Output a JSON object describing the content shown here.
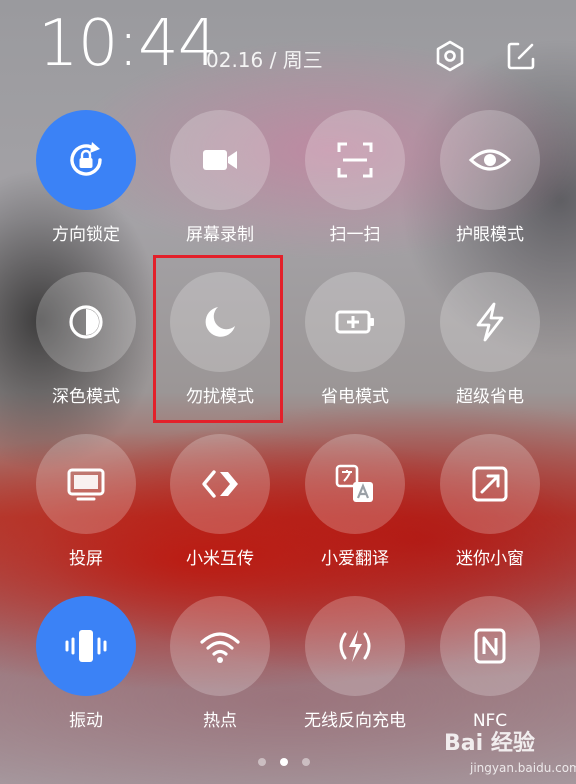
{
  "header": {
    "time": "10:44",
    "date": "02.16 / 周三",
    "settings_icon": "settings-hexagon-icon",
    "edit_icon": "edit-pencil-icon"
  },
  "accent_color": "#3b82f6",
  "highlight_color": "#e3202a",
  "tiles": [
    {
      "label": "方向锁定",
      "icon": "rotation-lock-icon",
      "active": true
    },
    {
      "label": "屏幕录制",
      "icon": "video-camera-icon",
      "active": false
    },
    {
      "label": "扫一扫",
      "icon": "scan-icon",
      "active": false
    },
    {
      "label": "护眼模式",
      "icon": "eye-icon",
      "active": false
    },
    {
      "label": "深色模式",
      "icon": "dark-mode-icon",
      "active": false
    },
    {
      "label": "勿扰模式",
      "icon": "moon-icon",
      "active": false,
      "highlighted": true
    },
    {
      "label": "省电模式",
      "icon": "battery-saver-icon",
      "active": false
    },
    {
      "label": "超级省电",
      "icon": "lightning-icon",
      "active": false
    },
    {
      "label": "投屏",
      "icon": "screen-cast-icon",
      "active": false
    },
    {
      "label": "小米互传",
      "icon": "mi-share-icon",
      "active": false
    },
    {
      "label": "小爱翻译",
      "icon": "translate-icon",
      "active": false
    },
    {
      "label": "迷你小窗",
      "icon": "mini-window-icon",
      "active": false
    },
    {
      "label": "振动",
      "icon": "vibrate-icon",
      "active": true
    },
    {
      "label": "热点",
      "icon": "hotspot-icon",
      "active": false
    },
    {
      "label": "无线反向充电",
      "icon": "reverse-charging-icon",
      "active": false
    },
    {
      "label": "NFC",
      "icon": "nfc-icon",
      "active": false
    }
  ],
  "pagination": {
    "pages": 3,
    "current": 2
  },
  "watermark": {
    "brand": "Bai 经验",
    "url": "jingyan.baidu.com"
  }
}
